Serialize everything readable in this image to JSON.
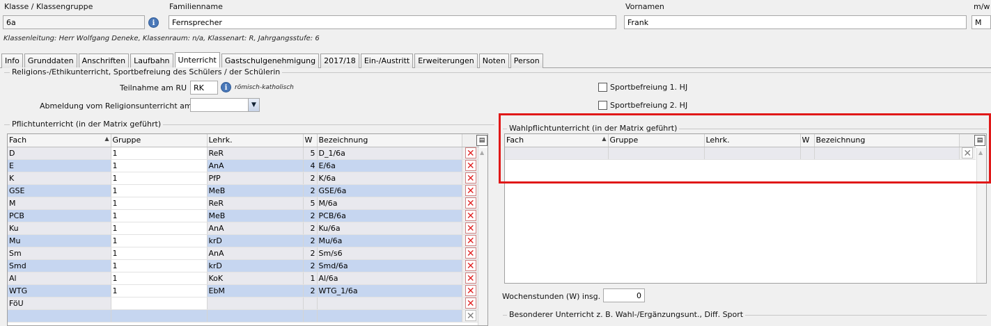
{
  "header": {
    "klasse_label": "Klasse / Klassengruppe",
    "klasse_value": "6a",
    "familienname_label": "Familienname",
    "familienname_value": "Fernsprecher",
    "vornamen_label": "Vornamen",
    "vornamen_value": "Frank",
    "mw_label": "m/w",
    "mw_value": "M",
    "klassenleitung": "Klassenleitung: Herr Wolfgang Deneke, Klassenraum: n/a, Klassenart: R, Jahrgangsstufe: 6"
  },
  "tabs": [
    "Info",
    "Grunddaten",
    "Anschriften",
    "Laufbahn",
    "Unterricht",
    "Gastschulgenehmigung",
    "2017/18",
    "Ein-/Austritt",
    "Erweiterungen",
    "Noten",
    "Person"
  ],
  "active_tab": "Unterricht",
  "religion": {
    "group_title": "Religions-/Ethikunterricht, Sportbefreiung des Schülers / der Schülerin",
    "teilnahme_label": "Teilnahme am RU",
    "teilnahme_value": "RK",
    "teilnahme_note": "römisch-katholisch",
    "abmeldung_label": "Abmeldung vom Religionsunterricht am",
    "abmeldung_value": "",
    "sport1_label": "Sportbefreiung 1. HJ",
    "sport2_label": "Sportbefreiung 2. HJ"
  },
  "pflicht": {
    "group_title": "Pflichtunterricht (in der Matrix geführt)",
    "columns": [
      "Fach",
      "Gruppe",
      "Lehrk.",
      "W",
      "Bezeichnung"
    ],
    "rows": [
      [
        "D",
        "1",
        "ReR",
        "5",
        "D_1/6a"
      ],
      [
        "E",
        "1",
        "AnA",
        "4",
        "E/6a"
      ],
      [
        "K",
        "1",
        "PfP",
        "2",
        "K/6a"
      ],
      [
        "GSE",
        "1",
        "MeB",
        "2",
        "GSE/6a"
      ],
      [
        "M",
        "1",
        "ReR",
        "5",
        "M/6a"
      ],
      [
        "PCB",
        "1",
        "MeB",
        "2",
        "PCB/6a"
      ],
      [
        "Ku",
        "1",
        "AnA",
        "2",
        "Ku/6a"
      ],
      [
        "Mu",
        "1",
        "krD",
        "2",
        "Mu/6a"
      ],
      [
        "Sm",
        "1",
        "AnA",
        "2",
        "Sm/s6"
      ],
      [
        "Smd",
        "1",
        "krD",
        "2",
        "Smd/6a"
      ],
      [
        "Al",
        "1",
        "KoK",
        "1",
        "Al/6a"
      ],
      [
        "WTG",
        "1",
        "EbM",
        "2",
        "WTG_1/6a"
      ],
      [
        "FöU",
        "",
        "",
        "",
        ""
      ],
      [
        "",
        "",
        "",
        "",
        ""
      ]
    ]
  },
  "wahlpflicht": {
    "group_title": "Wahlpflichtunterricht (in der Matrix geführt)",
    "columns": [
      "Fach",
      "Gruppe",
      "Lehrk.",
      "W",
      "Bezeichnung"
    ]
  },
  "wochenstunden": {
    "label": "Wochenstunden (W) insg.",
    "value": "0"
  },
  "besonderer": {
    "group_title": "Besonderer Unterricht z. B. Wahl-/Ergänzungsunt., Diff. Sport"
  },
  "colors": {
    "row_odd": "#e9e9ee",
    "row_even": "#c6d6f0",
    "highlight_border": "#e01818"
  }
}
